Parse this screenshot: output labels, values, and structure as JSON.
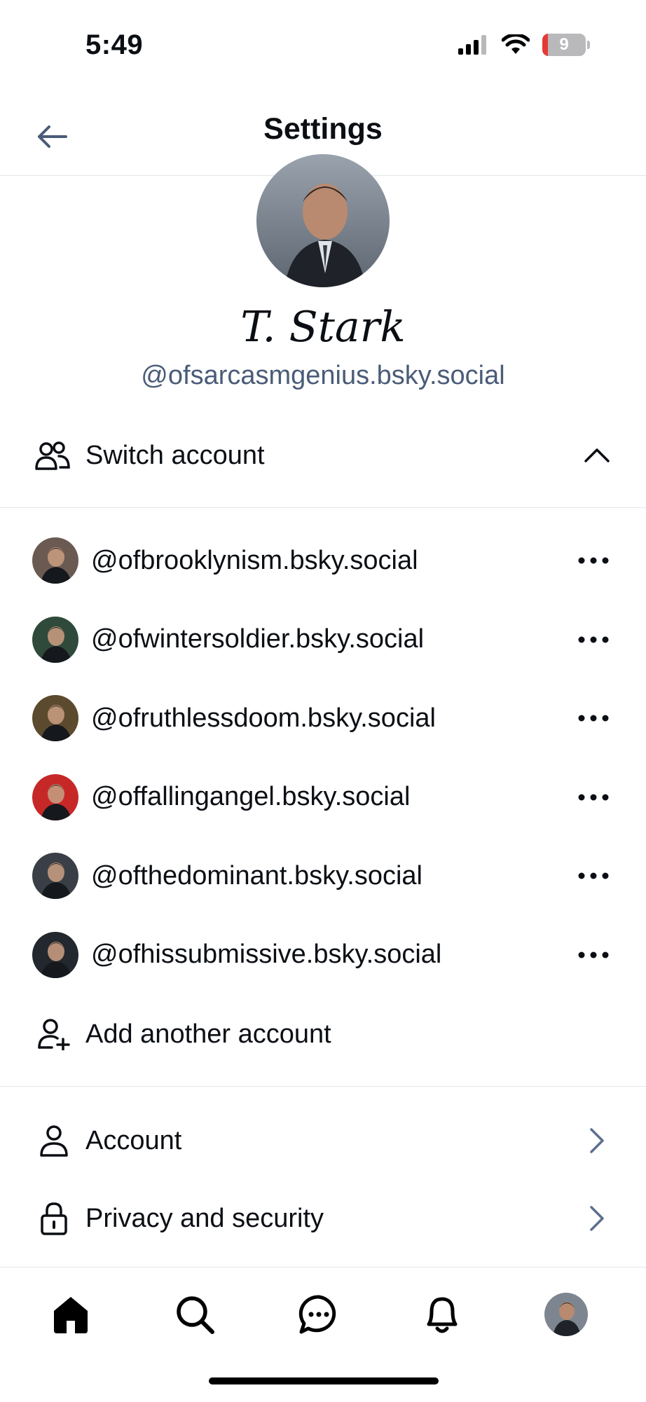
{
  "status_bar": {
    "time": "5:49",
    "battery_level": "9"
  },
  "header": {
    "title": "Settings"
  },
  "profile": {
    "display_name": "T. Stark",
    "handle": "@ofsarcasmgenius.bsky.social"
  },
  "switch_account": {
    "label": "Switch account"
  },
  "accounts": [
    {
      "handle": "@ofbrooklynism.bsky.social",
      "avatar_color": "#6b5a52"
    },
    {
      "handle": "@ofwintersoldier.bsky.social",
      "avatar_color": "#2f4a3a"
    },
    {
      "handle": "@ofruthlessdoom.bsky.social",
      "avatar_color": "#5c4a2e"
    },
    {
      "handle": "@offallingangel.bsky.social",
      "avatar_color": "#c62828"
    },
    {
      "handle": "@ofthedominant.bsky.social",
      "avatar_color": "#3a3f47"
    },
    {
      "handle": "@ofhissubmissive.bsky.social",
      "avatar_color": "#23272e"
    }
  ],
  "add_account": {
    "label": "Add another account"
  },
  "menu": [
    {
      "label": "Account",
      "icon": "person-icon"
    },
    {
      "label": "Privacy and security",
      "icon": "lock-icon"
    }
  ],
  "tabs": [
    "home-icon",
    "search-icon",
    "chat-icon",
    "bell-icon",
    "profile-avatar"
  ],
  "colors": {
    "accent_handle": "#4a5c78",
    "chevron": "#5b6f8f"
  }
}
